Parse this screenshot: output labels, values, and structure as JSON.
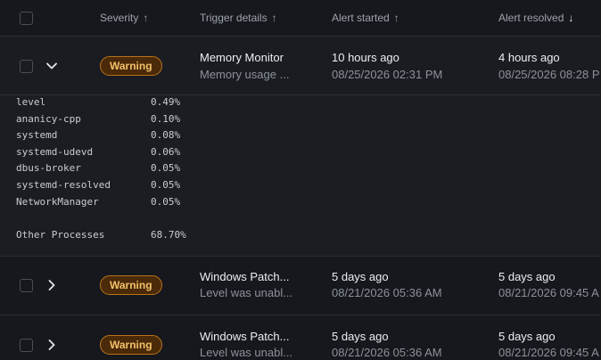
{
  "header": {
    "columns": [
      {
        "label": "Severity",
        "sort": "↑"
      },
      {
        "label": "Trigger details",
        "sort": "↑"
      },
      {
        "label": "Alert started",
        "sort": "↑"
      },
      {
        "label": "Alert resolved",
        "sort": "↓"
      }
    ]
  },
  "rows": [
    {
      "severity": "Warning",
      "trigger_title": "Memory Monitor",
      "trigger_sub": "Memory usage ...",
      "started_rel": "10 hours ago",
      "started_abs": "08/25/2026 02:31 PM",
      "resolved_rel": "4 hours ago",
      "resolved_abs": "08/25/2026 08:28 P",
      "expanded": true
    },
    {
      "severity": "Warning",
      "trigger_title": "Windows Patch...",
      "trigger_sub": "Level was unabl...",
      "started_rel": "5 days ago",
      "started_abs": "08/21/2026 05:36 AM",
      "resolved_rel": "5 days ago",
      "resolved_abs": "08/21/2026 09:45 A",
      "expanded": false
    },
    {
      "severity": "Warning",
      "trigger_title": "Windows Patch...",
      "trigger_sub": "Level was unabl...",
      "started_rel": "5 days ago",
      "started_abs": "08/21/2026 05:36 AM",
      "resolved_rel": "5 days ago",
      "resolved_abs": "08/21/2026 09:45 A",
      "expanded": false
    }
  ],
  "processes": [
    {
      "name": "level",
      "pct": "0.49%"
    },
    {
      "name": "ananicy-cpp",
      "pct": "0.10%"
    },
    {
      "name": "systemd",
      "pct": "0.08%"
    },
    {
      "name": "systemd-udevd",
      "pct": "0.06%"
    },
    {
      "name": "dbus-broker",
      "pct": "0.05%"
    },
    {
      "name": "systemd-resolved",
      "pct": "0.05%"
    },
    {
      "name": "NetworkManager",
      "pct": "0.05%"
    }
  ],
  "other_processes": {
    "name": "Other Processes",
    "pct": "68.70%"
  },
  "colors": {
    "background": "#16181d",
    "warning_badge_bg": "#4a2a08",
    "warning_badge_border": "#b8741a",
    "warning_badge_text": "#f3c06b"
  },
  "icons": {
    "expanded": "chevron-down-icon",
    "collapsed": "chevron-right-icon",
    "sort_asc": "arrow-up-icon",
    "sort_desc": "arrow-down-icon"
  }
}
